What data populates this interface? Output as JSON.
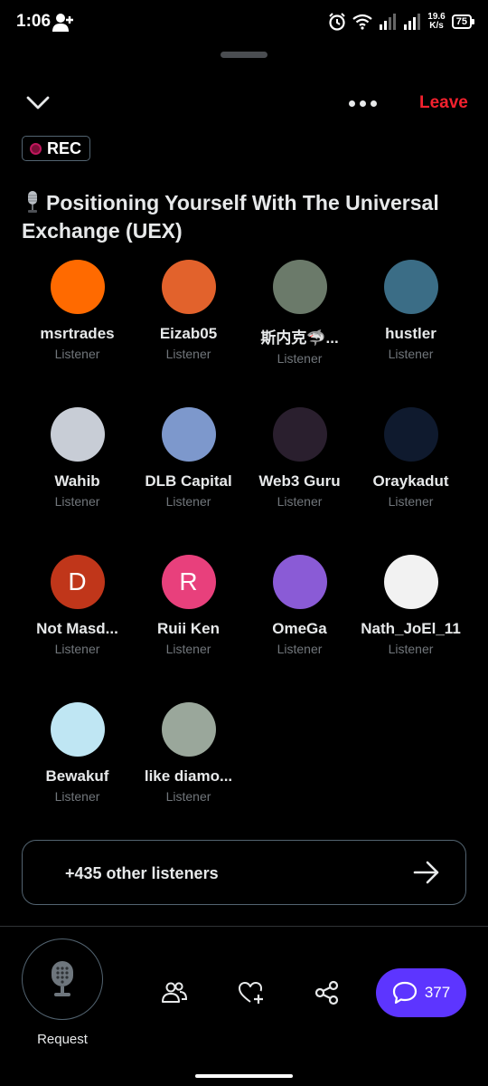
{
  "status_bar": {
    "time": "1:06",
    "net_speed_value": "19.6",
    "net_speed_unit": "K/s",
    "battery": "75"
  },
  "header": {
    "leave_label": "Leave",
    "rec_label": "REC"
  },
  "space": {
    "title": "Positioning Yourself With The Universal Exchange (UEX)"
  },
  "listeners": [
    {
      "name": "msrtrades",
      "role": "Listener",
      "avatar_color": "#ff6a00",
      "initial": ""
    },
    {
      "name": "Eizab05",
      "role": "Listener",
      "avatar_color": "#e2622c",
      "initial": ""
    },
    {
      "name": "斯内克🦈...",
      "role": "Listener",
      "avatar_color": "#6b7a6a",
      "initial": ""
    },
    {
      "name": "hustler",
      "role": "Listener",
      "avatar_color": "#3b6d86",
      "initial": ""
    },
    {
      "name": "Wahib",
      "role": "Listener",
      "avatar_color": "#c8cdd6",
      "initial": ""
    },
    {
      "name": "DLB Capital",
      "role": "Listener",
      "avatar_color": "#7d98cc",
      "initial": ""
    },
    {
      "name": "Web3 Guru",
      "role": "Listener",
      "avatar_color": "#2a1f2e",
      "initial": ""
    },
    {
      "name": "Oraykadut",
      "role": "Listener",
      "avatar_color": "#0f1a2e",
      "initial": ""
    },
    {
      "name": "Not Masd...",
      "role": "Listener",
      "avatar_color": "#c0361a",
      "initial": "D"
    },
    {
      "name": "Ruii Ken",
      "role": "Listener",
      "avatar_color": "#e8407c",
      "initial": "R"
    },
    {
      "name": "OmeGa",
      "role": "Listener",
      "avatar_color": "#8a5bd6",
      "initial": ""
    },
    {
      "name": "Nath_JoEl_11",
      "role": "Listener",
      "avatar_color": "#f2f2f2",
      "initial": ""
    },
    {
      "name": "Bewakuf",
      "role": "Listener",
      "avatar_color": "#bfe6f3",
      "initial": ""
    },
    {
      "name": "like diamo...",
      "role": "Listener",
      "avatar_color": "#9aa79b",
      "initial": ""
    }
  ],
  "others": {
    "label": "+435 other listeners"
  },
  "toolbar": {
    "request_label": "Request",
    "chat_count": "377"
  },
  "icons": {
    "back": "chevron-down-icon",
    "more": "more-dots-icon",
    "request": "microphone-icon",
    "people": "people-icon",
    "react": "heart-plus-icon",
    "share": "share-icon",
    "chat": "chat-bubble-icon"
  },
  "colors": {
    "leave": "#f4212e",
    "chat_button": "#5d35ff",
    "rec_dot": "#7a0e37"
  }
}
